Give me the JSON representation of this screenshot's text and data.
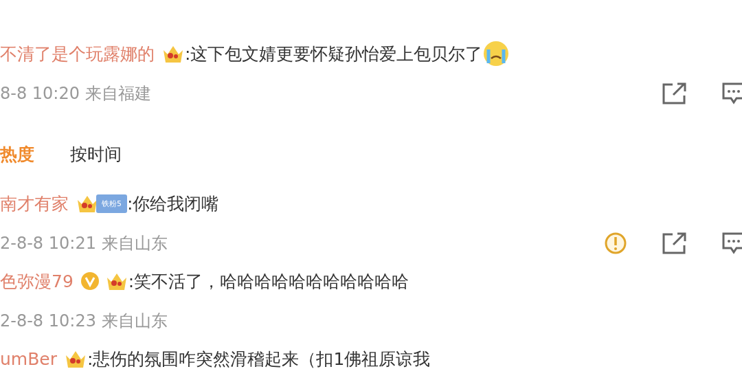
{
  "comment": {
    "user": "不清了是个玩露娜的",
    "badges": [
      {
        "kind": "crown"
      }
    ],
    "text": ":这下包文婧更要怀疑孙怡爱上包贝尔了",
    "trailing": [
      {
        "kind": "crying-emoji"
      }
    ],
    "time": "8-8 10:20 来自福建",
    "actions": [
      {
        "kind": "share"
      },
      {
        "kind": "comment"
      }
    ]
  },
  "sort_tabs": [
    {
      "label": "热度",
      "selected": true
    },
    {
      "label": "按时间",
      "selected": false
    }
  ],
  "replies": [
    {
      "user": "南才有家",
      "badges": [
        {
          "kind": "crown"
        },
        {
          "kind": "fan",
          "label": "铁粉5"
        }
      ],
      "text": ":你给我闭嘴",
      "time": "2-8-8 10:21 来自山东",
      "actions": [
        {
          "kind": "report"
        },
        {
          "kind": "share"
        },
        {
          "kind": "comment"
        }
      ]
    },
    {
      "user": "色弥漫79",
      "badges": [
        {
          "kind": "verified"
        },
        {
          "kind": "crown"
        }
      ],
      "text": ":笑不活了，哈哈哈哈哈哈哈哈哈哈哈",
      "time": "2-8-8 10:23 来自山东"
    },
    {
      "user": "umBer",
      "badges": [
        {
          "kind": "crown"
        }
      ],
      "text": ":悲伤的氛围咋突然滑稽起来（扣1佛祖原谅我"
    }
  ]
}
